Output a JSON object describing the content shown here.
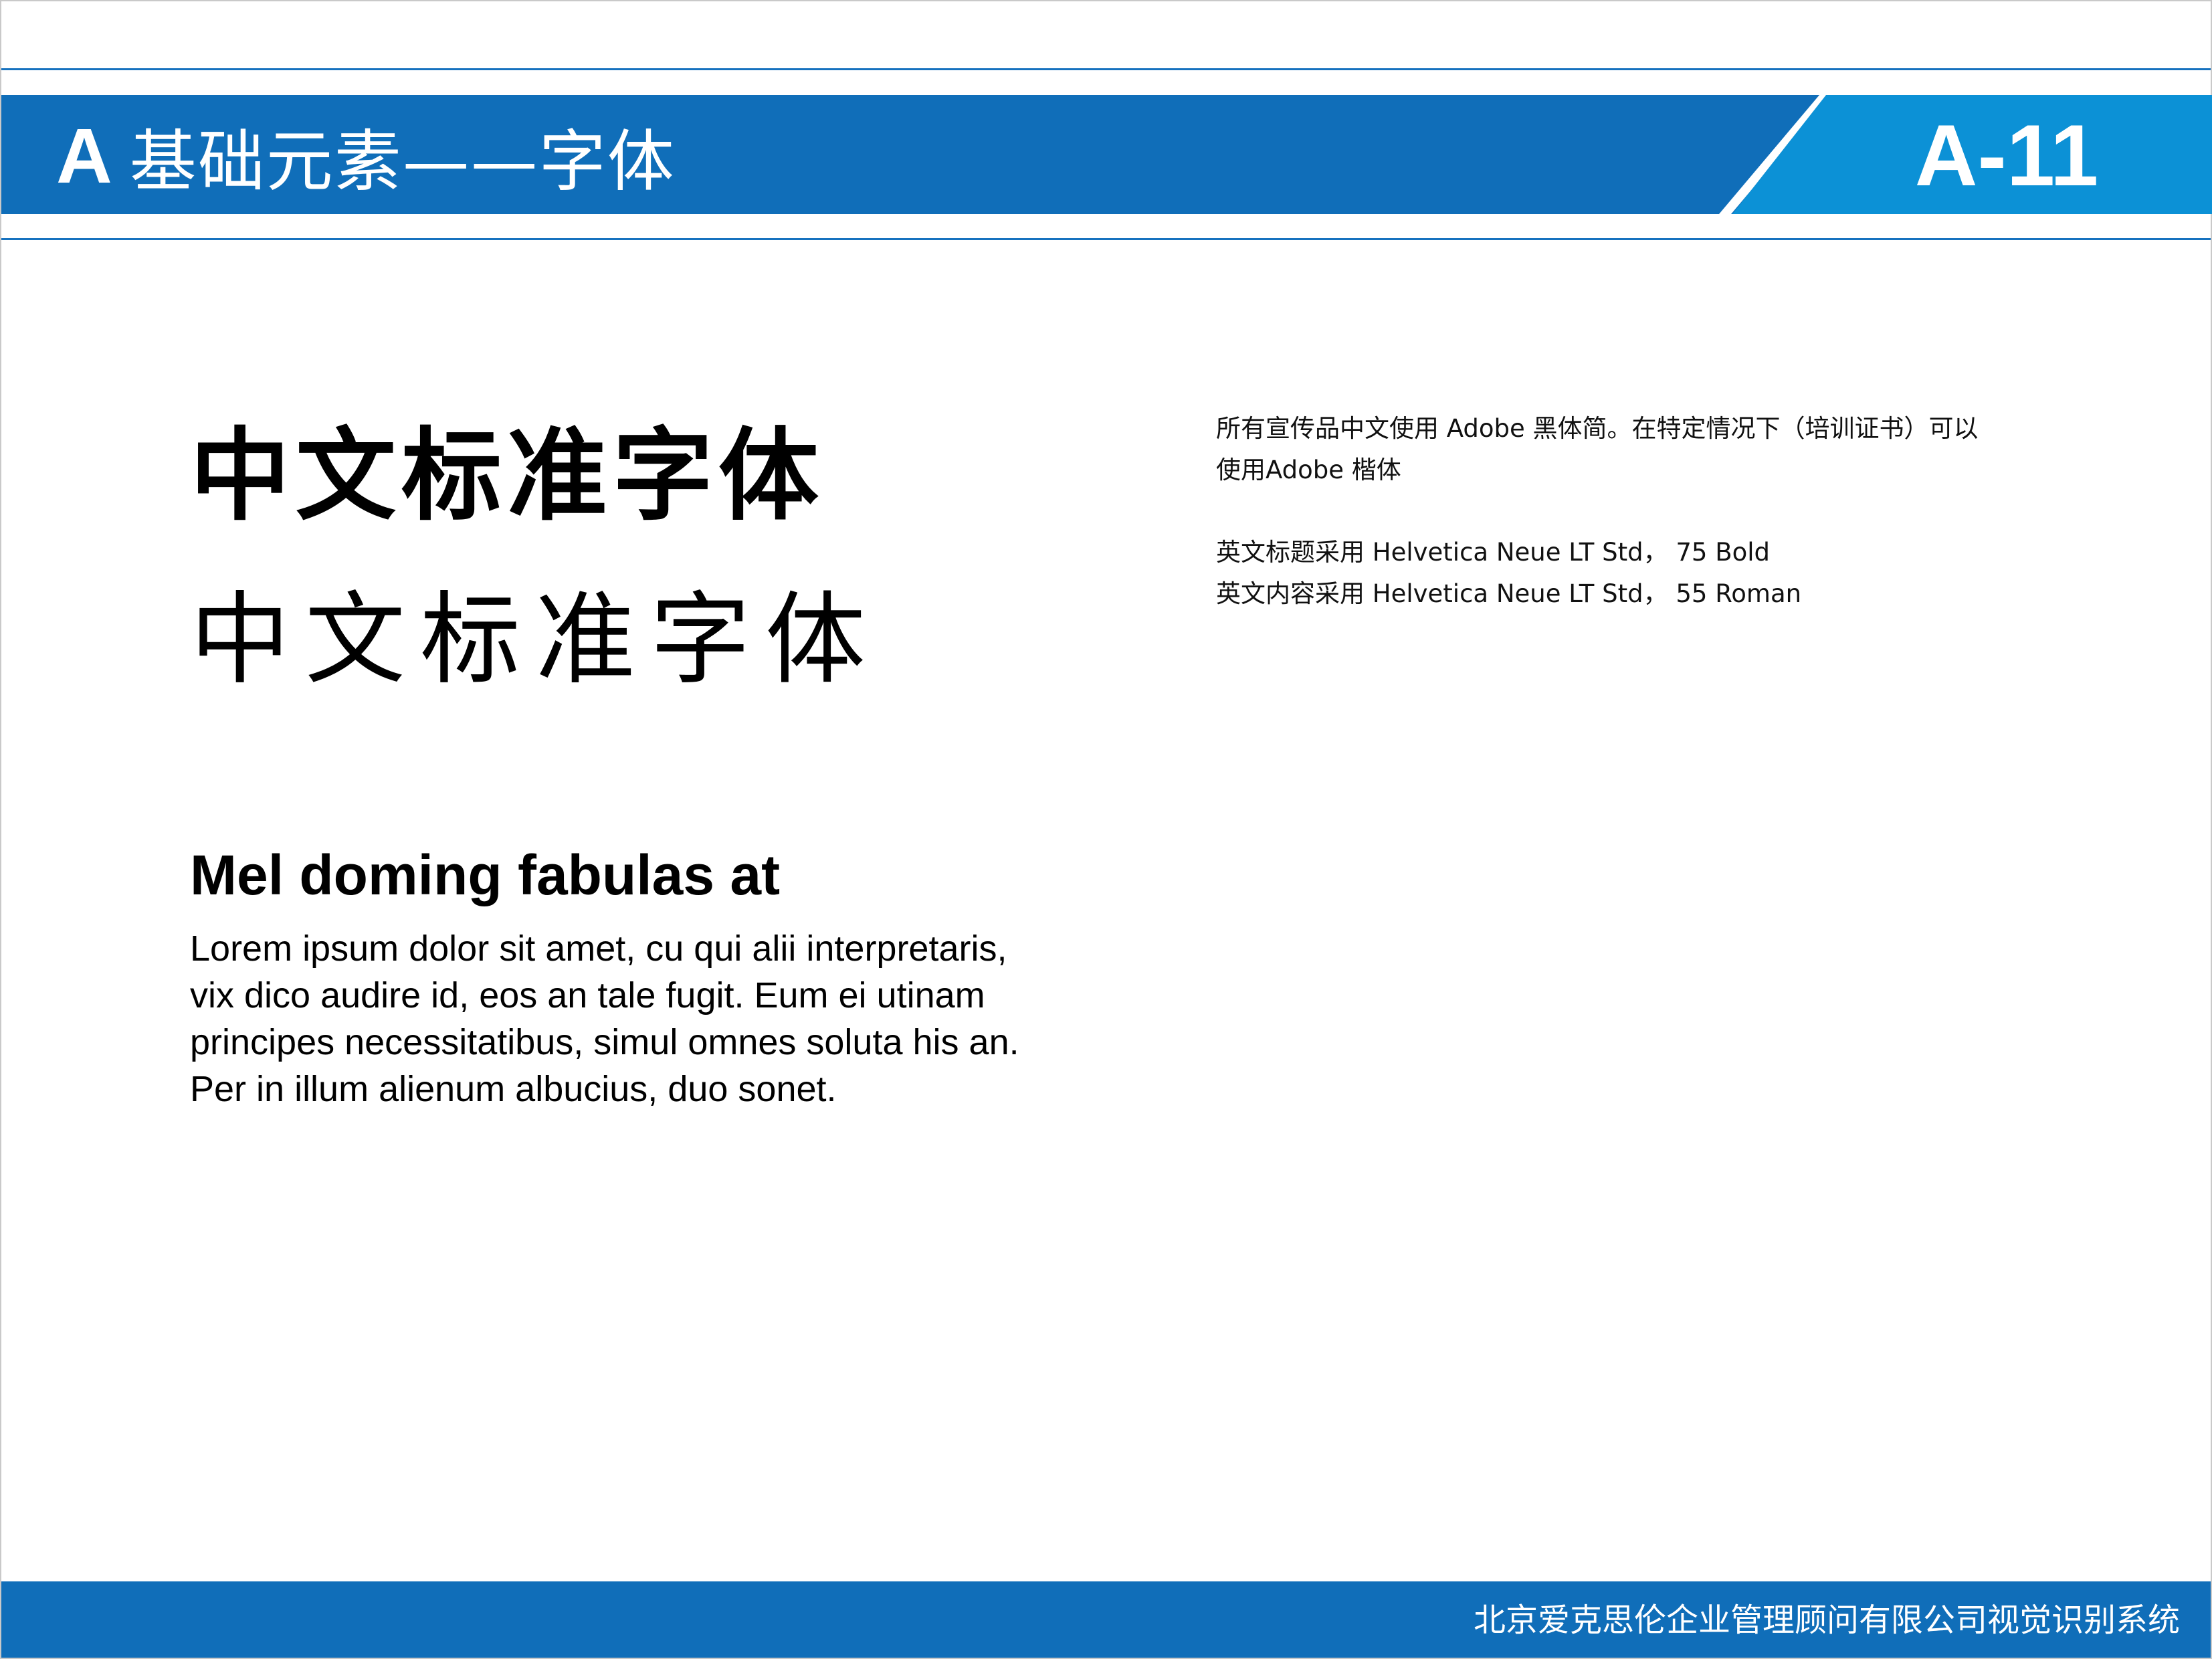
{
  "header": {
    "section_letter": "A",
    "section_name": "基础元素——字体",
    "page_number": "A-11"
  },
  "samples": {
    "chinese_heiti": "中文标准字体",
    "chinese_kaiti": "中文标准字体"
  },
  "notes": {
    "chinese_font_line1": "所有宣传品中文使用 Adobe 黑体简。在特定情况下（培训证书）可以",
    "chinese_font_line2": "使用Adobe 楷体",
    "english_title_font": "英文标题采用 Helvetica Neue LT Std，  75 Bold",
    "english_body_font": "英文内容采用  Helvetica Neue LT Std，  55 Roman"
  },
  "english_sample": {
    "heading": "Mel doming fabulas at",
    "body_lines": [
      "Lorem ipsum dolor sit amet, cu qui alii interpretaris,",
      "vix dico audire id, eos an tale fugit. Eum ei utinam",
      "principes necessitatibus, simul omnes soluta his an.",
      "Per in illum alienum albucius, duo sonet."
    ]
  },
  "footer": {
    "company_system": "北京爱克思伦企业管理顾问有限公司视觉识别系统"
  },
  "colors": {
    "brand_blue": "#106eb9",
    "accent_blue": "#0c91d6",
    "rule_blue": "#1672bf",
    "text": "#000000",
    "background": "#ffffff"
  }
}
